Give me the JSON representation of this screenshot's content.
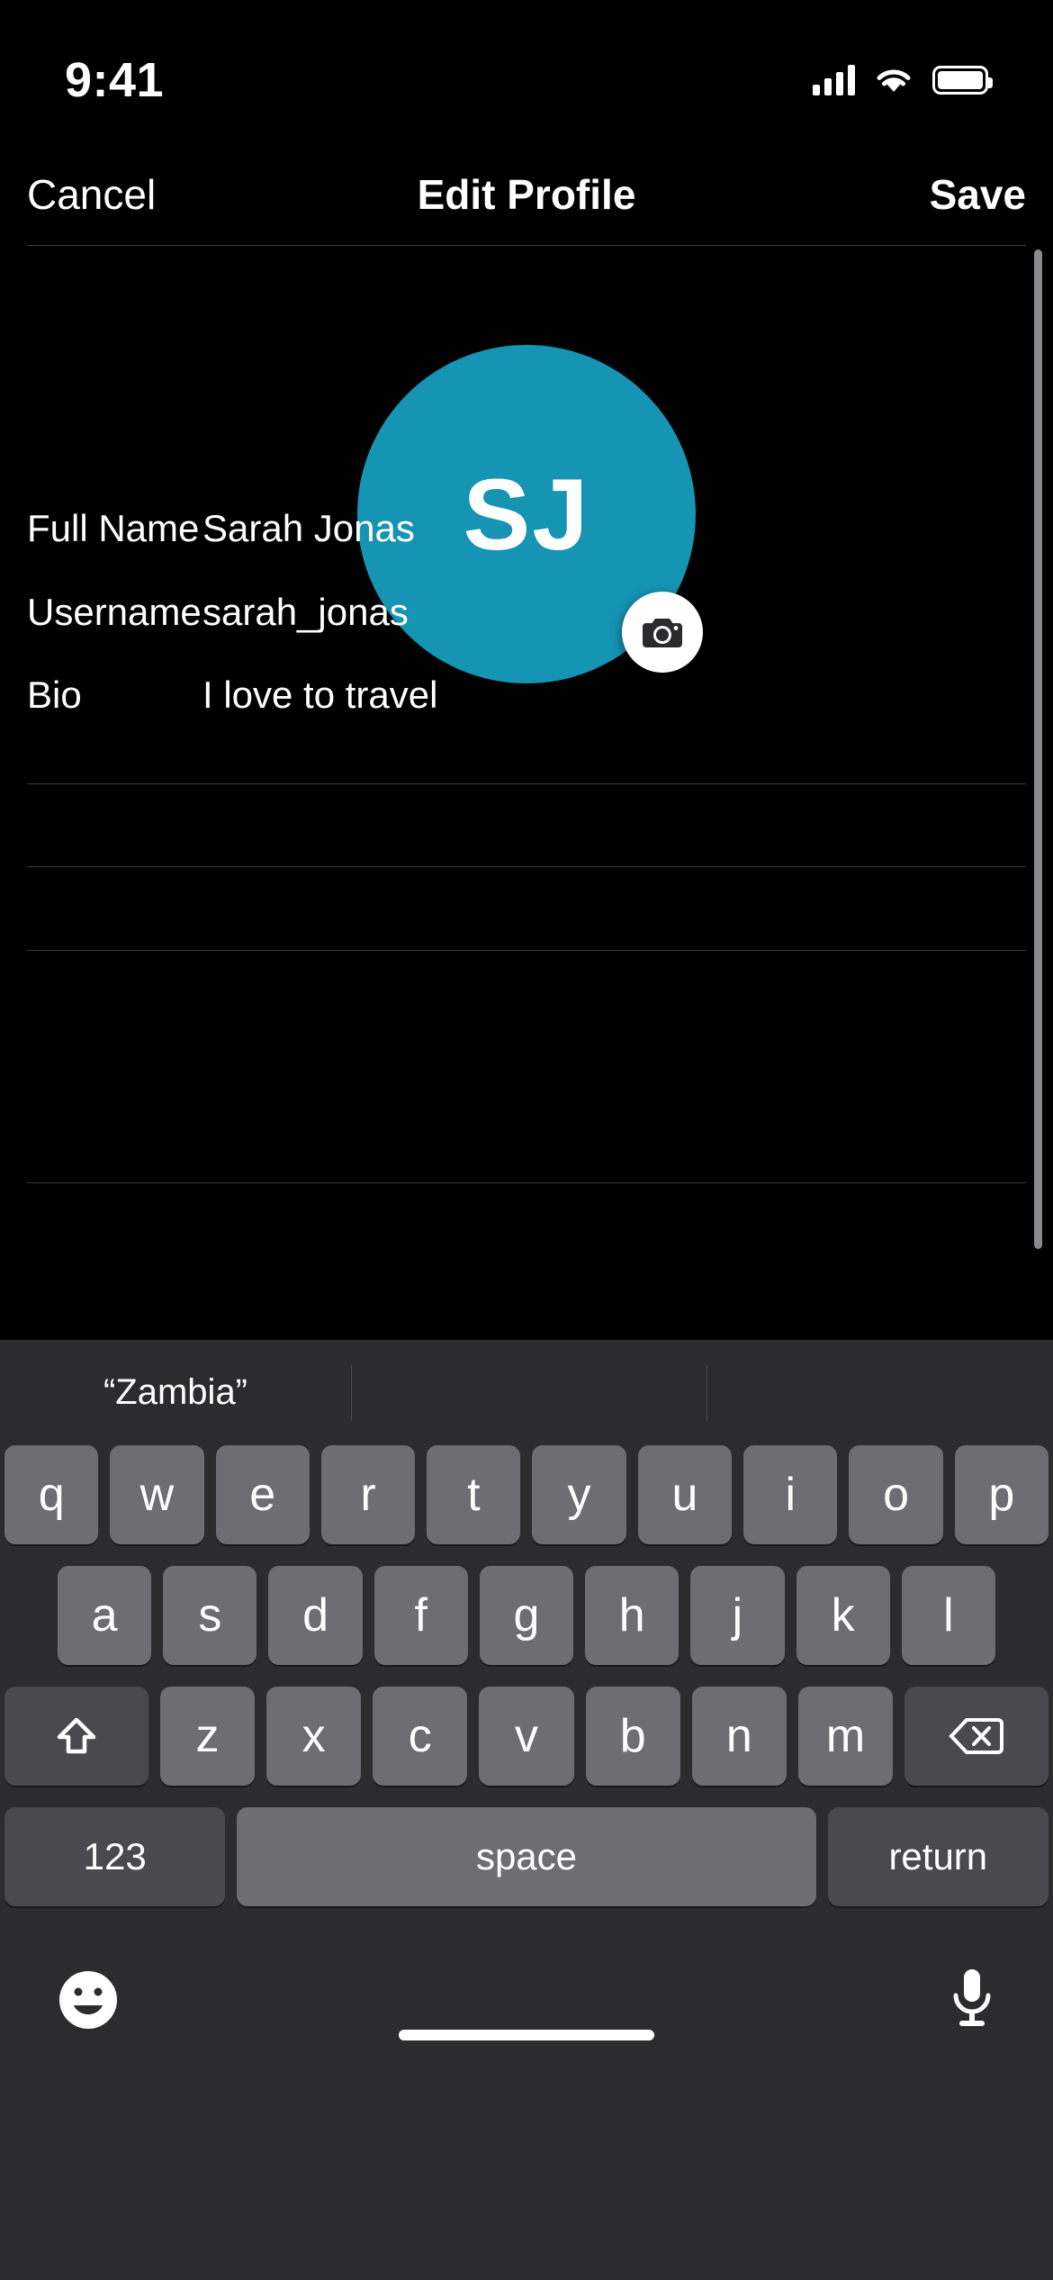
{
  "status_bar": {
    "time": "9:41",
    "icons": [
      "cellular-signal-icon",
      "wifi-icon",
      "battery-icon"
    ]
  },
  "nav_bar": {
    "cancel_label": "Cancel",
    "title": "Edit Profile",
    "save_label": "Save"
  },
  "profile": {
    "avatar_initials": "SJ",
    "avatar_color": "#1694b4",
    "camera_badge_icon": "camera-icon"
  },
  "form": {
    "fields": [
      {
        "label": "Full Name",
        "value": "Sarah Jonas"
      },
      {
        "label": "Username",
        "value": "sarah_jonas"
      },
      {
        "label": "Bio",
        "value": "I love to travel"
      }
    ]
  },
  "keyboard": {
    "suggestions": [
      "“Zambia”",
      "",
      ""
    ],
    "row1": [
      "q",
      "w",
      "e",
      "r",
      "t",
      "y",
      "u",
      "i",
      "o",
      "p"
    ],
    "row2": [
      "a",
      "s",
      "d",
      "f",
      "g",
      "h",
      "j",
      "k",
      "l"
    ],
    "row3_letters": [
      "z",
      "x",
      "c",
      "v",
      "b",
      "n",
      "m"
    ],
    "shift_icon": "shift-arrow-icon",
    "backspace_icon": "backspace-icon",
    "numeric_label": "123",
    "space_label": "space",
    "return_label": "return",
    "emoji_icon": "emoji-smiley-icon",
    "mic_icon": "microphone-icon"
  }
}
